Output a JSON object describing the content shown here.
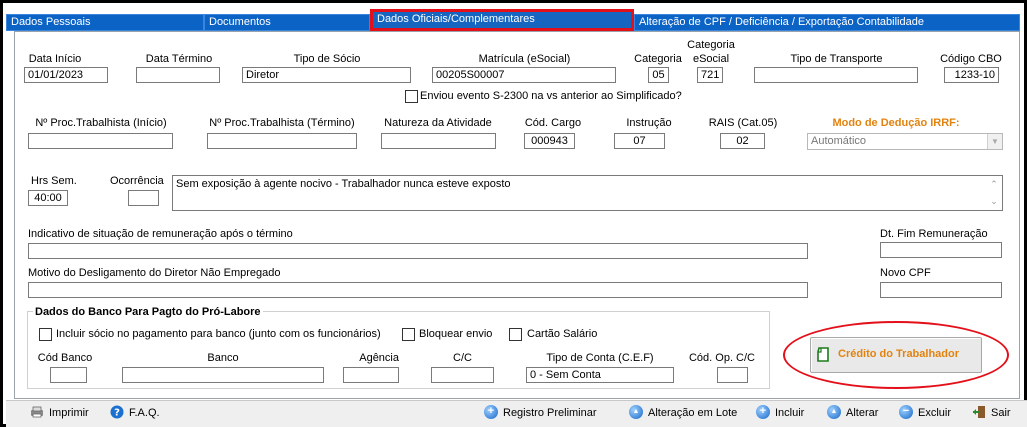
{
  "tabs": [
    {
      "label": "Dados Pessoais"
    },
    {
      "label": "Documentos"
    },
    {
      "label": "Dados Oficiais/Complementares"
    },
    {
      "label": "Alteração de CPF / Deficiência / Exportação Contabilidade"
    }
  ],
  "row1": {
    "data_inicio": {
      "label": "Data Início",
      "value": "01/01/2023"
    },
    "data_termino": {
      "label": "Data Término",
      "value": ""
    },
    "tipo_socio": {
      "label": "Tipo de Sócio",
      "value": "Diretor"
    },
    "matricula": {
      "label": "Matrícula (eSocial)",
      "value": "00205S00007"
    },
    "categoria": {
      "label": "Categoria",
      "value": "05"
    },
    "categoria_esocial": {
      "label_line1": "Categoria",
      "label_line2": "eSocial",
      "value": "721"
    },
    "tipo_transporte": {
      "label": "Tipo de Transporte",
      "value": ""
    },
    "codigo_cbo": {
      "label": "Código CBO",
      "value": "1233-10"
    }
  },
  "s2300_checkbox": {
    "label": "Enviou evento S-2300 na vs anterior ao Simplificado?",
    "checked": false
  },
  "row2": {
    "proc_inicio": {
      "label": "Nº Proc.Trabalhista (Início)",
      "value": ""
    },
    "proc_termino": {
      "label": "Nº Proc.Trabalhista (Término)",
      "value": ""
    },
    "natureza": {
      "label": "Natureza da Atividade",
      "value": ""
    },
    "cod_cargo": {
      "label": "Cód. Cargo",
      "value": "000943"
    },
    "instrucao": {
      "label": "Instrução",
      "value": "07"
    },
    "rais": {
      "label": "RAIS (Cat.05)",
      "value": "02"
    },
    "modo_deducao": {
      "label": "Modo de Dedução IRRF:",
      "value": "Automático"
    }
  },
  "row3": {
    "hrs_sem": {
      "label": "Hrs Sem.",
      "value": "40:00"
    },
    "ocorrencia": {
      "label": "Ocorrência",
      "value": "",
      "description": "Sem exposição à agente nocivo - Trabalhador nunca esteve exposto"
    }
  },
  "indicativo": {
    "label": "Indicativo de situação de remuneração após o término",
    "value": ""
  },
  "dt_fim_rem": {
    "label": "Dt. Fim Remuneração",
    "value": ""
  },
  "motivo": {
    "label": "Motivo do Desligamento do Diretor Não Empregado",
    "value": ""
  },
  "novo_cpf": {
    "label": "Novo CPF",
    "value": ""
  },
  "banco_group": {
    "title": "Dados do Banco Para Pagto do Pró-Labore",
    "incluir": {
      "label": "Incluir sócio no pagamento para banco (junto com os funcionários)",
      "checked": false
    },
    "bloquear": {
      "label": "Bloquear envio",
      "checked": false
    },
    "cartao": {
      "label": "Cartão Salário",
      "checked": false
    },
    "cod_banco": {
      "label": "Cód Banco",
      "value": ""
    },
    "banco": {
      "label": "Banco",
      "value": ""
    },
    "agencia": {
      "label": "Agência",
      "value": ""
    },
    "cc": {
      "label": "C/C",
      "value": ""
    },
    "tipo_conta": {
      "label": "Tipo de Conta (C.E.F)",
      "value": "0 - Sem Conta"
    },
    "cod_op": {
      "label": "Cód. Op. C/C",
      "value": ""
    }
  },
  "credito_button": {
    "label": "Crédito do Trabalhador",
    "icon": "document-icon"
  },
  "footer": {
    "imprimir": "Imprimir",
    "faq": "F.A.Q.",
    "registro": "Registro Preliminar",
    "alteracao_lote": "Alteração em Lote",
    "incluir": "Incluir",
    "alterar": "Alterar",
    "excluir": "Excluir",
    "sair": "Sair"
  },
  "colors": {
    "tab_blue": "#0c63c6",
    "highlight_red": "#e3101a",
    "accent_orange": "#e2830f"
  }
}
